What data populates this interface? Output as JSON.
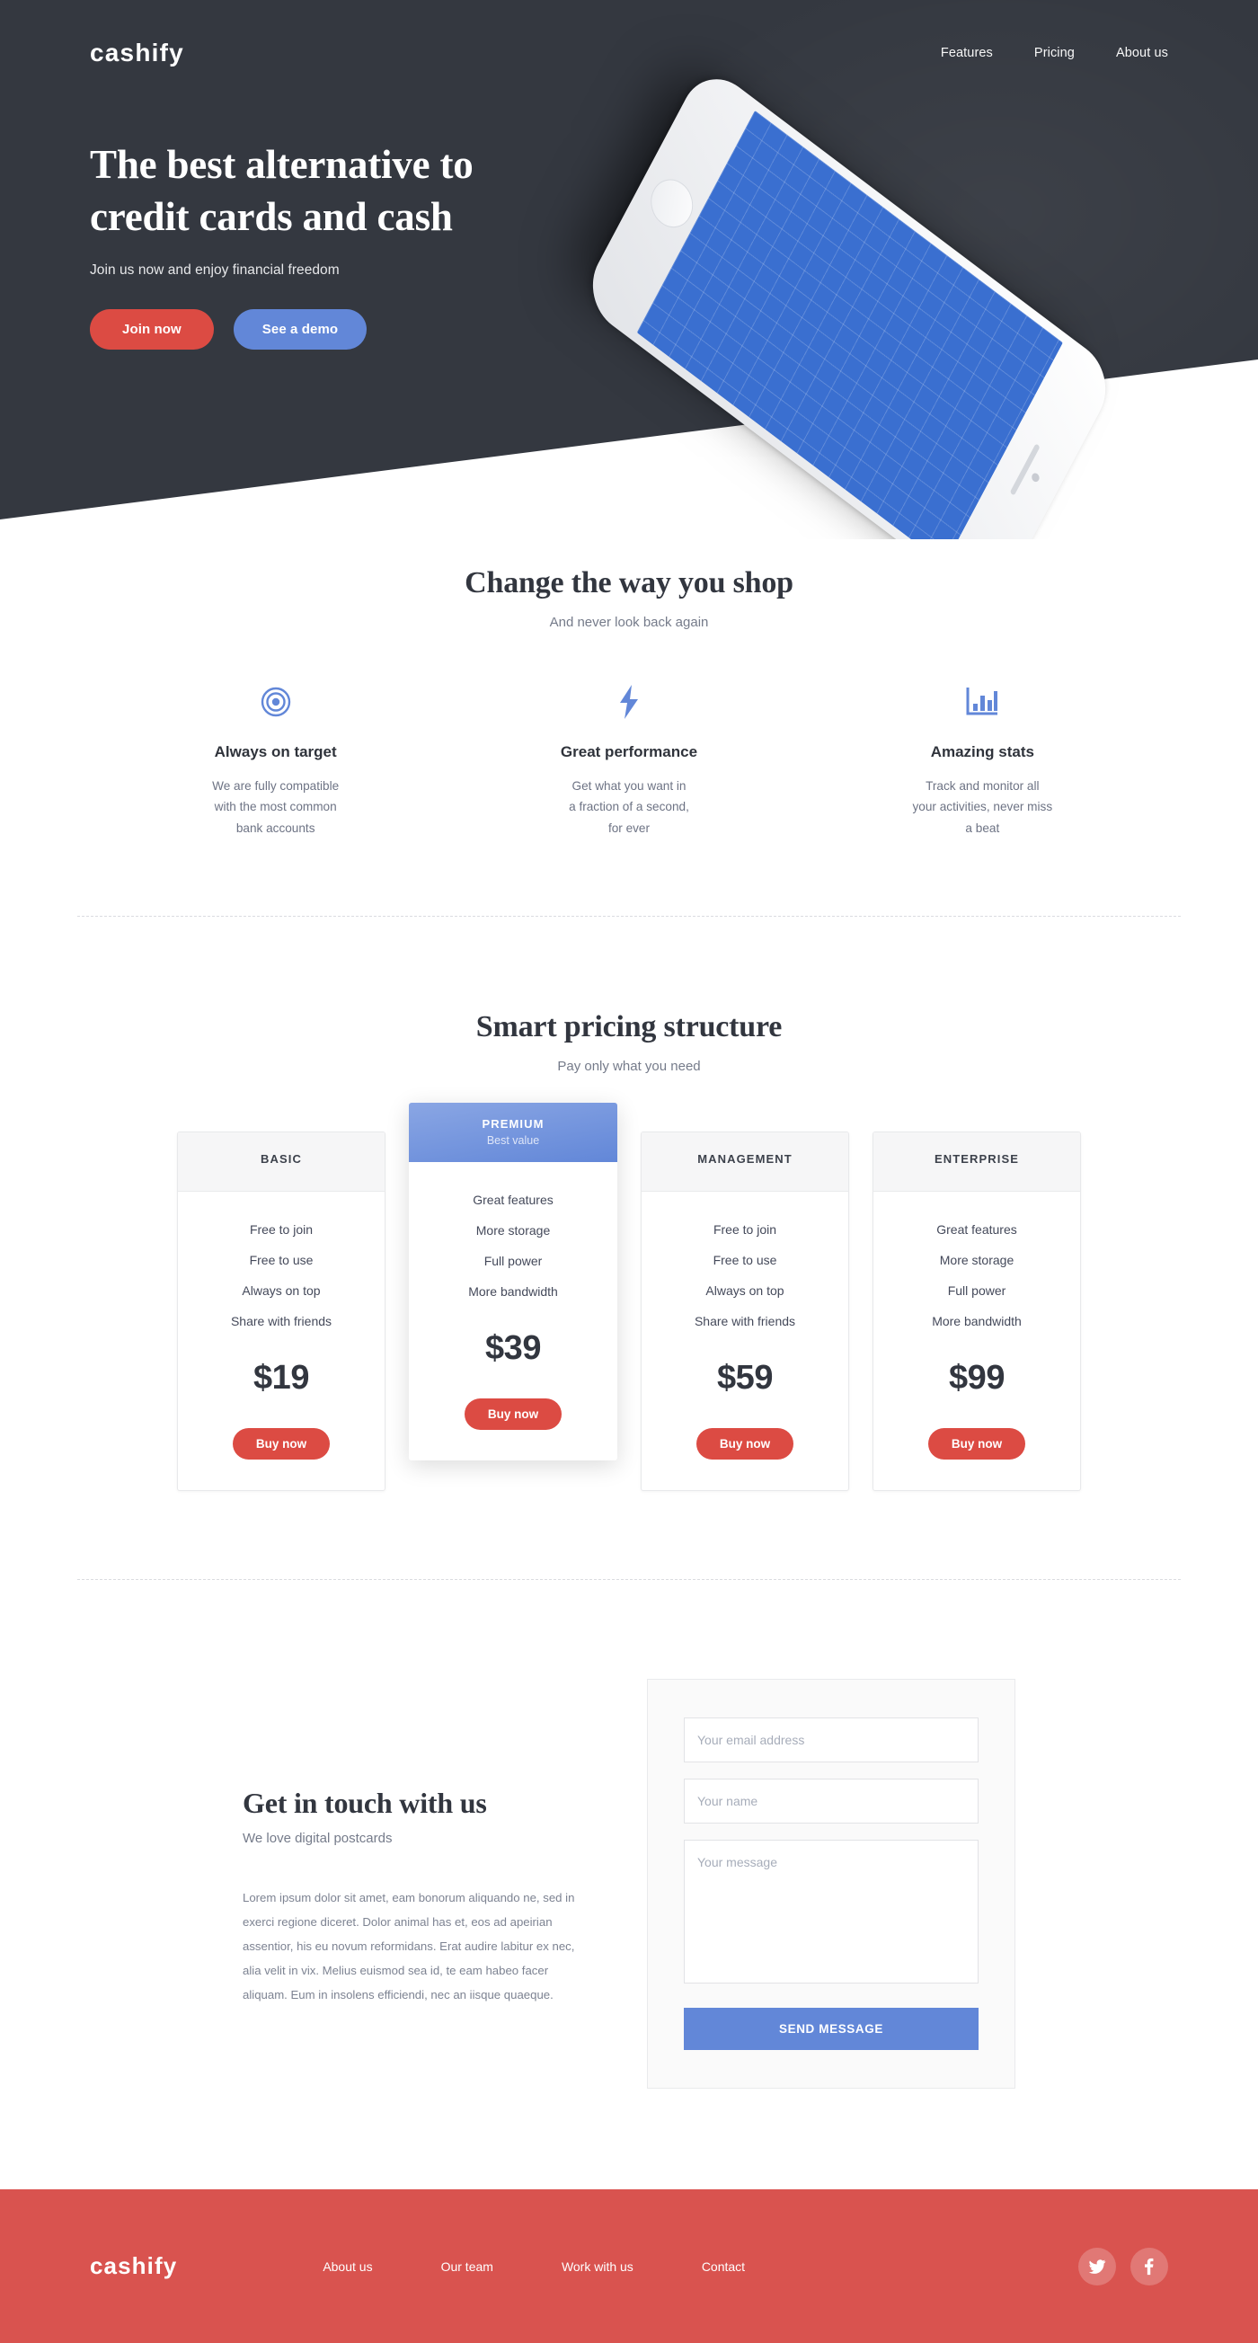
{
  "brand": {
    "name": "cashify",
    "accent_red": "#dc4b43",
    "accent_blue": "#6287d8",
    "dark": "#343840",
    "footer_red": "#d9534f"
  },
  "nav": {
    "logo": "cashify",
    "links": [
      {
        "label": "Features"
      },
      {
        "label": "Pricing"
      },
      {
        "label": "About us"
      }
    ]
  },
  "hero": {
    "title_line1": "The best alternative to",
    "title_line2": "credit cards and cash",
    "subtitle": "Join us now and enjoy financial freedom",
    "primary_button": "Join now",
    "secondary_button": "See a demo"
  },
  "features_section": {
    "title": "Change the way you shop",
    "subtitle": "And never look back again",
    "items": [
      {
        "icon": "target-icon",
        "title": "Always on target",
        "desc": "We are fully compatible\nwith the most common\nbank accounts"
      },
      {
        "icon": "lightning-bolt-icon",
        "title": "Great performance",
        "desc": "Get what you want in\na fraction of a second,\nfor ever"
      },
      {
        "icon": "bar-chart-icon",
        "title": "Amazing stats",
        "desc": "Track and monitor all\nyour activities, never miss\na beat"
      }
    ]
  },
  "pricing_section": {
    "title": "Smart pricing structure",
    "subtitle": "Pay only what you need",
    "plans": [
      {
        "name": "BASIC",
        "badge": "",
        "featured": false,
        "features": [
          "Free to join",
          "Free to use",
          "Always on top",
          "Share with friends"
        ],
        "price": "$19",
        "cta": "Buy now"
      },
      {
        "name": "PREMIUM",
        "badge": "Best value",
        "featured": true,
        "features": [
          "Great features",
          "More storage",
          "Full power",
          "More bandwidth"
        ],
        "price": "$39",
        "cta": "Buy now"
      },
      {
        "name": "MANAGEMENT",
        "badge": "",
        "featured": false,
        "features": [
          "Free to join",
          "Free to use",
          "Always on top",
          "Share with friends"
        ],
        "price": "$59",
        "cta": "Buy now"
      },
      {
        "name": "ENTERPRISE",
        "badge": "",
        "featured": false,
        "features": [
          "Great features",
          "More storage",
          "Full power",
          "More bandwidth"
        ],
        "price": "$99",
        "cta": "Buy now"
      }
    ]
  },
  "contact_section": {
    "title": "Get in touch with us",
    "subtitle": "We love digital postcards",
    "body": "Lorem ipsum dolor sit amet, eam bonorum aliquando ne, sed in exerci regione diceret. Dolor animal has et, eos ad apeirian assentior, his eu novum reformidans. Erat audire labitur ex nec, alia velit in vix. Melius euismod sea id, te eam habeo facer aliquam. Eum in insolens efficiendi, nec an iisque quaeque.",
    "form": {
      "email_placeholder": "Your email address",
      "email_value": "",
      "name_placeholder": "Your name",
      "name_value": "",
      "message_placeholder": "Your message",
      "message_value": "",
      "submit_label": "SEND MESSAGE"
    }
  },
  "footer": {
    "logo": "cashify",
    "links": [
      {
        "label": "About us"
      },
      {
        "label": "Our team"
      },
      {
        "label": "Work with us"
      },
      {
        "label": "Contact"
      }
    ],
    "socials": [
      {
        "icon": "twitter-icon"
      },
      {
        "icon": "facebook-icon"
      }
    ]
  }
}
